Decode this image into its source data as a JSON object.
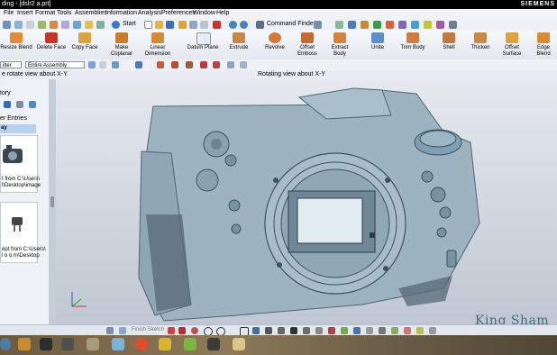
{
  "title_bar": {
    "title": "ding - [dslr2 a.prt]",
    "brand": "SIEMENS"
  },
  "menu": [
    "File",
    "Insert",
    "Format",
    "Tools",
    "Assemblies",
    "Information",
    "Analysis",
    "Preferences",
    "Window",
    "Help"
  ],
  "toolbar": {
    "start_label": "Start",
    "command_finder": "Command Finder"
  },
  "ribbon": [
    "Resize Blend",
    "Delete Face",
    "Copy Face",
    "Make Coplanar",
    "Linear Dimension",
    "Datum Plane",
    "Extrude",
    "Revolve",
    "Offset Emboss",
    "Extract Body",
    "Unite",
    "Trim Body",
    "Shell",
    "Thicken",
    "Offset Surface",
    "Edge Blend"
  ],
  "filter": {
    "label": "ilter",
    "scope": "Entire Assembly"
  },
  "status": {
    "left": "e rotate view about X-Y",
    "center": "Rotating view about X-Y"
  },
  "nav_panel": {
    "title": "tory",
    "entries_header": "er Entries",
    "section": "ay",
    "item1": [
      "t from C:\\Users\\",
      "l\\Desktop\\image"
    ],
    "item2": [
      "ept from C:\\Users\\",
      "l o o m\\Desktop"
    ]
  },
  "bottom_toolbar": {
    "finish_sketch": "Finish Sketch"
  },
  "watermark": "King Sham",
  "colors": {
    "ribbon_bg": "#e8ecf2",
    "viewport_bg": "#d3d9e1",
    "model": "#9fb4c0",
    "titlebar": "#000000"
  }
}
